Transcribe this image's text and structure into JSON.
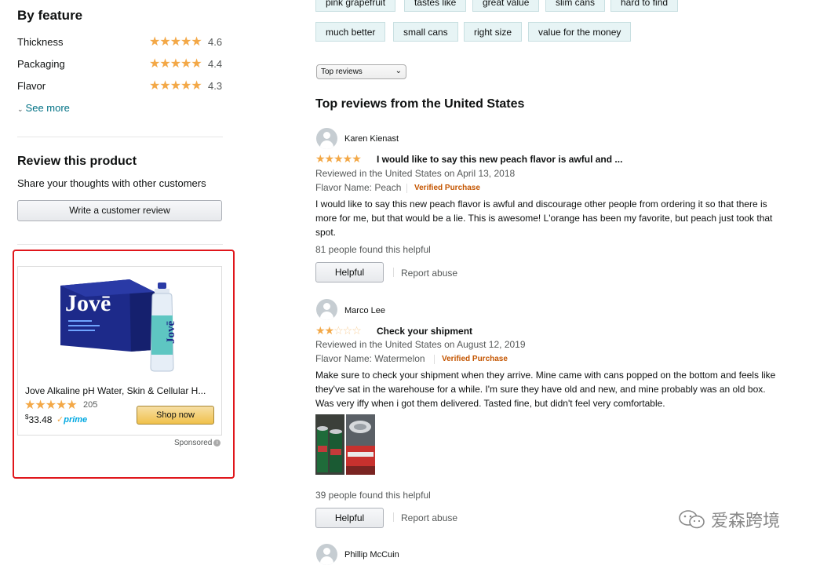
{
  "by_feature": {
    "heading": "By feature",
    "rows": [
      {
        "label": "Thickness",
        "rating": 4.6,
        "stars": "★★★★★",
        "value": "4.6"
      },
      {
        "label": "Packaging",
        "rating": 4.4,
        "stars": "★★★★★",
        "value": "4.4"
      },
      {
        "label": "Flavor",
        "rating": 4.3,
        "stars": "★★★★★",
        "value": "4.3"
      }
    ],
    "see_more": "See more"
  },
  "review_product": {
    "heading": "Review this product",
    "subtext": "Share your thoughts with other customers",
    "button": "Write a customer review"
  },
  "ad": {
    "title": "Jove Alkaline pH Water, Skin & Cellular H...",
    "stars": "★★★★★",
    "rating": 4.5,
    "count": "205",
    "price_symbol": "$",
    "price": "33.48",
    "prime": "prime",
    "shop_button": "Shop now",
    "sponsored": "Sponsored",
    "info": "i",
    "brand_box": "Jovē",
    "brand_bottle": "Jovē"
  },
  "chips": {
    "row1": [
      "pink grapefruit",
      "tastes like",
      "great value",
      "slim cans",
      "hard to find"
    ],
    "row2": [
      "much better",
      "small cans",
      "right size",
      "value for the money"
    ]
  },
  "sort": {
    "selected": "Top reviews",
    "chevron": "⌄"
  },
  "top_reviews_heading": "Top reviews from the United States",
  "reviews": [
    {
      "name": "Karen Kienast",
      "stars_full": "★★★★★",
      "stars_empty": "",
      "rating": 5,
      "title": "I would like to say this new peach flavor is awful and ...",
      "date": "Reviewed in the United States on April 13, 2018",
      "flavor": "Flavor Name: Peach",
      "verified": "Verified Purchase",
      "body": "I would like to say this new peach flavor is awful and discourage other people from ordering it so that there is more for me, but that would be a lie. This is awesome! L'orange has been my favorite, but peach just took that spot.",
      "helpful_count": "81 people found this helpful",
      "helpful_button": "Helpful",
      "report": "Report abuse"
    },
    {
      "name": "Marco Lee",
      "stars_full": "★★",
      "stars_empty": "☆☆☆",
      "rating": 2,
      "title": "Check your shipment",
      "date": "Reviewed in the United States on August 12, 2019",
      "flavor": "Flavor Name: Watermelon",
      "verified": "Verified Purchase",
      "body": "Make sure to check your shipment when they arrive. Mine came with cans popped on the bottom and feels like they've sat in the warehouse for a while. I'm sure they have old and new, and mine probably was an old box. Was very iffy when i got them delivered. Tasted fine, but didn't feel very comfortable.",
      "helpful_count": "39 people found this helpful",
      "helpful_button": "Helpful",
      "report": "Report abuse"
    }
  ],
  "next_reviewer_partial": "Phillip McCuin",
  "watermark": "爱森跨境",
  "colors": {
    "star": "#f3a847",
    "link": "#007185",
    "verified": "#c45500",
    "ad_outline": "#e0161b",
    "chip_bg": "#e7f4f5"
  }
}
